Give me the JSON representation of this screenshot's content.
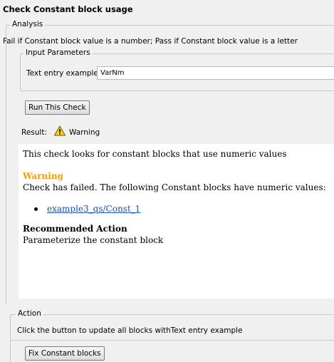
{
  "title": "Check Constant block usage",
  "analysis": {
    "legend": "Analysis",
    "description": "Fail if Constant block value is a number; Pass if Constant block value is a letter",
    "input_parameters": {
      "legend": "Input Parameters",
      "field_label": "Text entry example",
      "field_value": "VarNm"
    },
    "run_button": "Run This Check",
    "result_label": "Result:",
    "result_status": "Warning",
    "report": {
      "intro": "This check looks for constant blocks that use numeric values",
      "warning_heading": "Warning",
      "warning_text": "Check has failed. The following Constant blocks have numeric values:",
      "items": [
        "example3_qs/Const_1"
      ],
      "recommended_heading": "Recommended Action",
      "recommended_text": "Parameterize the constant block"
    }
  },
  "action": {
    "legend": "Action",
    "description": "Click the button to update all blocks withText entry example",
    "fix_button": "Fix Constant blocks"
  },
  "colors": {
    "warning": "#f5a000",
    "link": "#1f4fa8"
  },
  "icons": {
    "warning": "warning-triangle-icon"
  }
}
